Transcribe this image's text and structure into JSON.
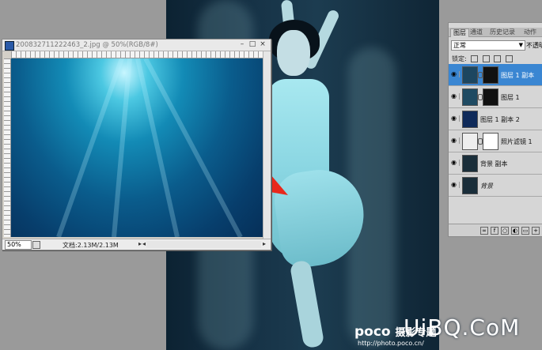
{
  "document": {
    "title": "200832711222463_2.jpg @ 50%(RGB/8#)",
    "zoom": "50%",
    "doc_info": "文档:2.13M/2.13M"
  },
  "layers_panel": {
    "tabs": [
      "图层",
      "通道",
      "历史记录",
      "动作"
    ],
    "blend_mode": "正常",
    "opacity_label": "不透明",
    "lock_label": "锁定:",
    "layers": [
      {
        "name": "图层 1 副本",
        "selected": true
      },
      {
        "name": "图层 1",
        "selected": false
      },
      {
        "name": "图层 1 副本 2",
        "selected": false
      },
      {
        "name": "照片滤镜 1",
        "selected": false
      },
      {
        "name": "背景 副本",
        "selected": false
      },
      {
        "name": "背景",
        "selected": false
      }
    ],
    "bottom_icons": [
      "link-icon",
      "fx-icon",
      "mask-icon",
      "adjustment-icon",
      "group-icon",
      "new-layer-icon",
      "trash-icon"
    ]
  },
  "watermark": {
    "poco": "poco",
    "poco_cn": "摄影专题",
    "url": "http://photo.poco.cn/",
    "uibq": "UiBQ.CoM"
  },
  "colors": {
    "accent_arrow": "#e8281c",
    "selected_layer": "#3a86d2"
  }
}
